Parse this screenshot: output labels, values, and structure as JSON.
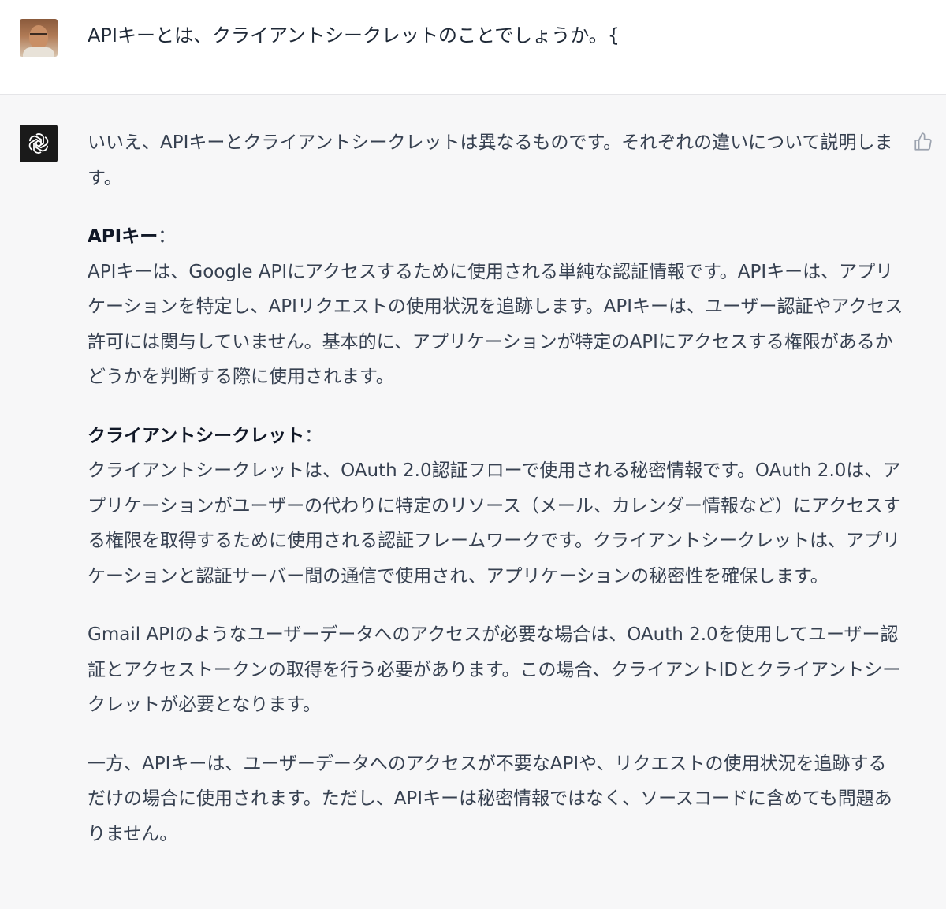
{
  "user_message": {
    "avatar": "user-avatar-photo",
    "text": "APIキーとは、クライアントシークレットのことでしょうか。{"
  },
  "assistant_message": {
    "icon": "openai-logo-icon",
    "feedback_icon": "thumbs-up-icon",
    "intro": "いいえ、APIキーとクライアントシークレットは異なるものです。それぞれの違いについて説明します。",
    "sections": [
      {
        "heading": "APIキー",
        "colon": "：",
        "body": "APIキーは、Google APIにアクセスするために使用される単純な認証情報です。APIキーは、アプリケーションを特定し、APIリクエストの使用状況を追跡します。APIキーは、ユーザー認証やアクセス許可には関与していません。基本的に、アプリケーションが特定のAPIにアクセスする権限があるかどうかを判断する際に使用されます。"
      },
      {
        "heading": "クライアントシークレット",
        "colon": "：",
        "body": "クライアントシークレットは、OAuth 2.0認証フローで使用される秘密情報です。OAuth 2.0は、アプリケーションがユーザーの代わりに特定のリソース（メール、カレンダー情報など）にアクセスする権限を取得するために使用される認証フレームワークです。クライアントシークレットは、アプリケーションと認証サーバー間の通信で使用され、アプリケーションの秘密性を確保します。"
      }
    ],
    "paragraph_gmail": "Gmail APIのようなユーザーデータへのアクセスが必要な場合は、OAuth 2.0を使用してユーザー認証とアクセストークンの取得を行う必要があります。この場合、クライアントIDとクライアントシークレットが必要となります。",
    "paragraph_apikey": "一方、APIキーは、ユーザーデータへのアクセスが不要なAPIや、リクエストの使用状況を追跡するだけの場合に使用されます。ただし、APIキーは秘密情報ではなく、ソースコードに含めても問題ありません。"
  }
}
